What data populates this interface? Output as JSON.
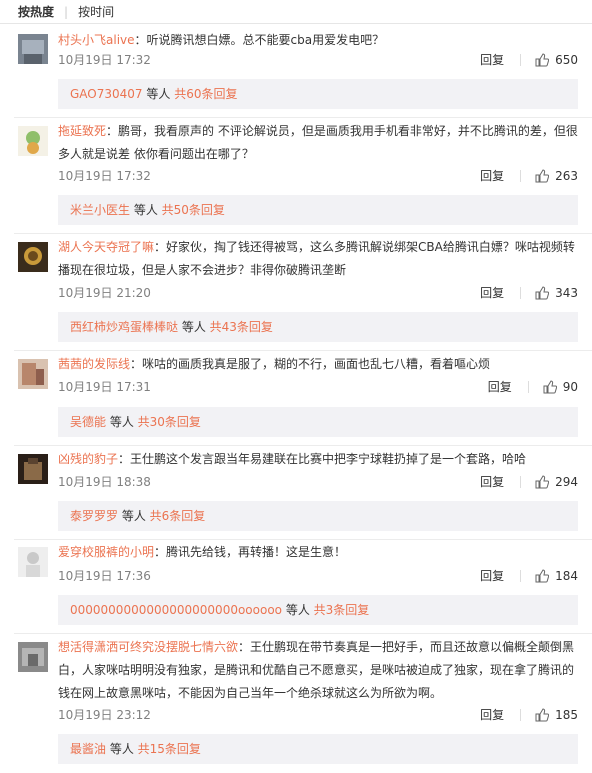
{
  "tabs": [
    {
      "label": "按热度"
    },
    {
      "label": "按时间"
    }
  ],
  "reply_label": "回复",
  "comments": [
    {
      "user": "村头小飞alive",
      "text": "：听说腾讯想白嫖。总不能要cba用爱发电吧？",
      "time": "10月19日 17:32",
      "likes": "650",
      "reply_user": "GAO730407",
      "reply_mid": " 等人 ",
      "reply_count": "共60条回复"
    },
    {
      "user": "拖延致死",
      "text": "：鹏哥，我看原声的 不评论解说员，但是画质我用手机看非常好，并不比腾讯的差，但很多人就是说差 依你看问题出在哪了？",
      "time": "10月19日 17:32",
      "likes": "263",
      "reply_user": "米兰小医生",
      "reply_mid": " 等人 ",
      "reply_count": "共50条回复"
    },
    {
      "user": "湖人今天夺冠了嘛",
      "text": "：好家伙，掏了钱还得被骂，这么多腾讯解说绑架CBA给腾讯白嫖？咪咕视频转播现在很垃圾，但是人家不会进步？非得你破腾讯垄断",
      "time": "10月19日 21:20",
      "likes": "343",
      "reply_user": "西红柿炒鸡蛋棒棒哒",
      "reply_mid": " 等人 ",
      "reply_count": "共43条回复"
    },
    {
      "user": "茜茜的发际线",
      "text": "：咪咕的画质我真是服了，糊的不行，画面也乱七八糟，看着嘔心烦",
      "time": "10月19日 17:31",
      "likes": "90",
      "reply_user": "吴德能",
      "reply_mid": " 等人 ",
      "reply_count": "共30条回复"
    },
    {
      "user": "凶残的豹子",
      "text": "：王仕鹏这个发言跟当年易建联在比赛中把李宁球鞋扔掉了是一个套路，哈哈",
      "time": "10月19日 18:38",
      "likes": "294",
      "reply_user": "泰罗罗罗",
      "reply_mid": " 等人 ",
      "reply_count": "共6条回复"
    },
    {
      "user": "爱穿校服裤的小明",
      "text": "：腾讯先给钱，再转播！这是生意！",
      "time": "10月19日 17:36",
      "likes": "184",
      "reply_user": "0000000000000000000000oooooo",
      "reply_mid": " 等人 ",
      "reply_count": "共3条回复"
    },
    {
      "user": "想活得潇洒可终究没摆脱七情六欲",
      "text": "：王仕鹏现在带节奏真是一把好手，而且还故意以偏概全颠倒黑白，人家咪咕明明没有独家，是腾讯和优酷自己不愿意买，是咪咕被迫成了独家，现在拿了腾讯的钱在网上故意黑咪咕，不能因为自己当年一个绝杀球就这么为所欲为啊。",
      "time": "10月19日 23:12",
      "likes": "185",
      "reply_user": "最酱油",
      "reply_mid": " 等人 ",
      "reply_count": "共15条回复"
    }
  ],
  "colors": {
    "link": "#eb7350",
    "reply_bg": "#f2f2f5",
    "meta": "#808080"
  }
}
